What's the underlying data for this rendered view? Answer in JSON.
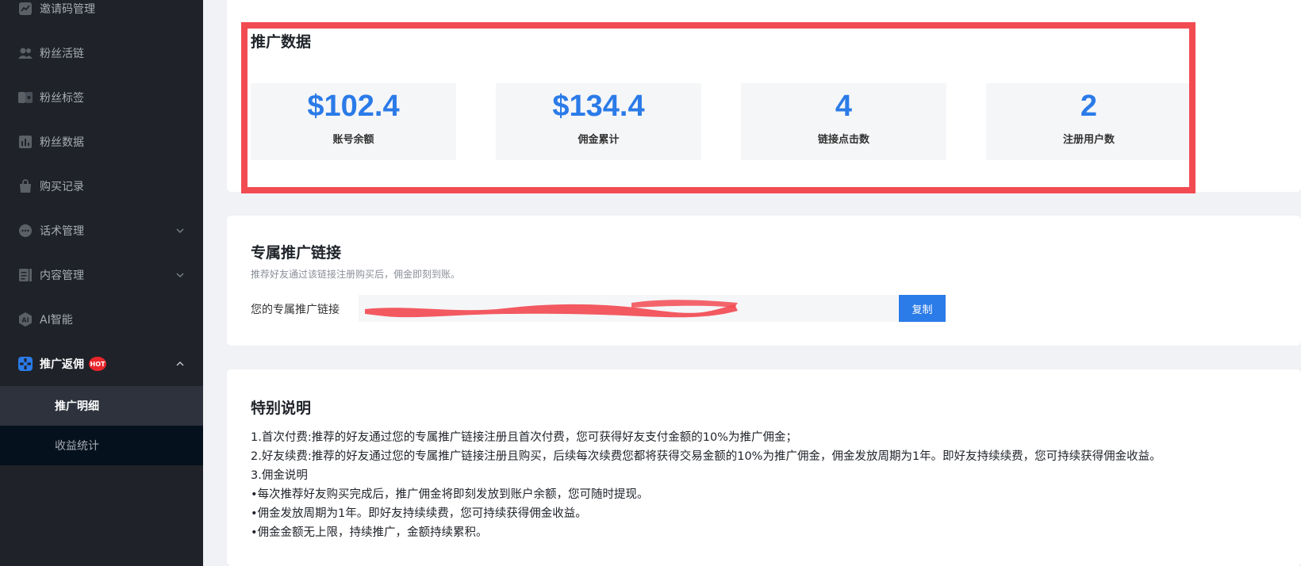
{
  "sidebar": {
    "items": [
      {
        "label": "邀请码管理",
        "icon": "chart-line-icon"
      },
      {
        "label": "粉丝活链",
        "icon": "users-icon"
      },
      {
        "label": "粉丝标签",
        "icon": "tag-icon"
      },
      {
        "label": "粉丝数据",
        "icon": "bar-chart-icon"
      },
      {
        "label": "购买记录",
        "icon": "shopping-bag-icon"
      },
      {
        "label": "话术管理",
        "icon": "chat-icon"
      },
      {
        "label": "内容管理",
        "icon": "document-icon"
      },
      {
        "label": "AI智能",
        "icon": "ai-icon"
      },
      {
        "label": "推广返佣",
        "icon": "promotion-icon",
        "badge": "HOT"
      }
    ],
    "sub_items": [
      {
        "label": "推广明细"
      },
      {
        "label": "收益统计"
      }
    ]
  },
  "stats_section": {
    "title": "推广数据",
    "stats": [
      {
        "value": "$102.4",
        "label": "账号余额"
      },
      {
        "value": "$134.4",
        "label": "佣金累计"
      },
      {
        "value": "4",
        "label": "链接点击数"
      },
      {
        "value": "2",
        "label": "注册用户数"
      }
    ]
  },
  "link_section": {
    "title": "专属推广链接",
    "subtitle": "推荐好友通过该链接注册购买后，佣金即刻到账。",
    "label": "您的专属推广链接",
    "copy_label": "复制"
  },
  "notes_section": {
    "title": "特别说明",
    "lines": [
      "1.首次付费:推荐的好友通过您的专属推广链接注册且首次付费，您可获得好友支付金额的10%为推广佣金；",
      "2.好友续费:推荐的好友通过您的专属推广链接注册且购买，后续每次续费您都将获得交易金额的10%为推广佣金，佣金发放周期为1年。即好友持续续费，您可持续获得佣金收益。",
      "3.佣金说明",
      "•每次推荐好友购买完成后，推广佣金将即刻发放到账户余额，您可随时提现。",
      "•佣金发放周期为1年。即好友持续续费，您可持续获得佣金收益。",
      "•佣金金额无上限，持续推广，金额持续累积。"
    ]
  },
  "colors": {
    "accent": "#2b7be8",
    "highlight": "#f24b52",
    "sidebar_bg": "#1f2228",
    "hot_badge": "#e8262b"
  }
}
